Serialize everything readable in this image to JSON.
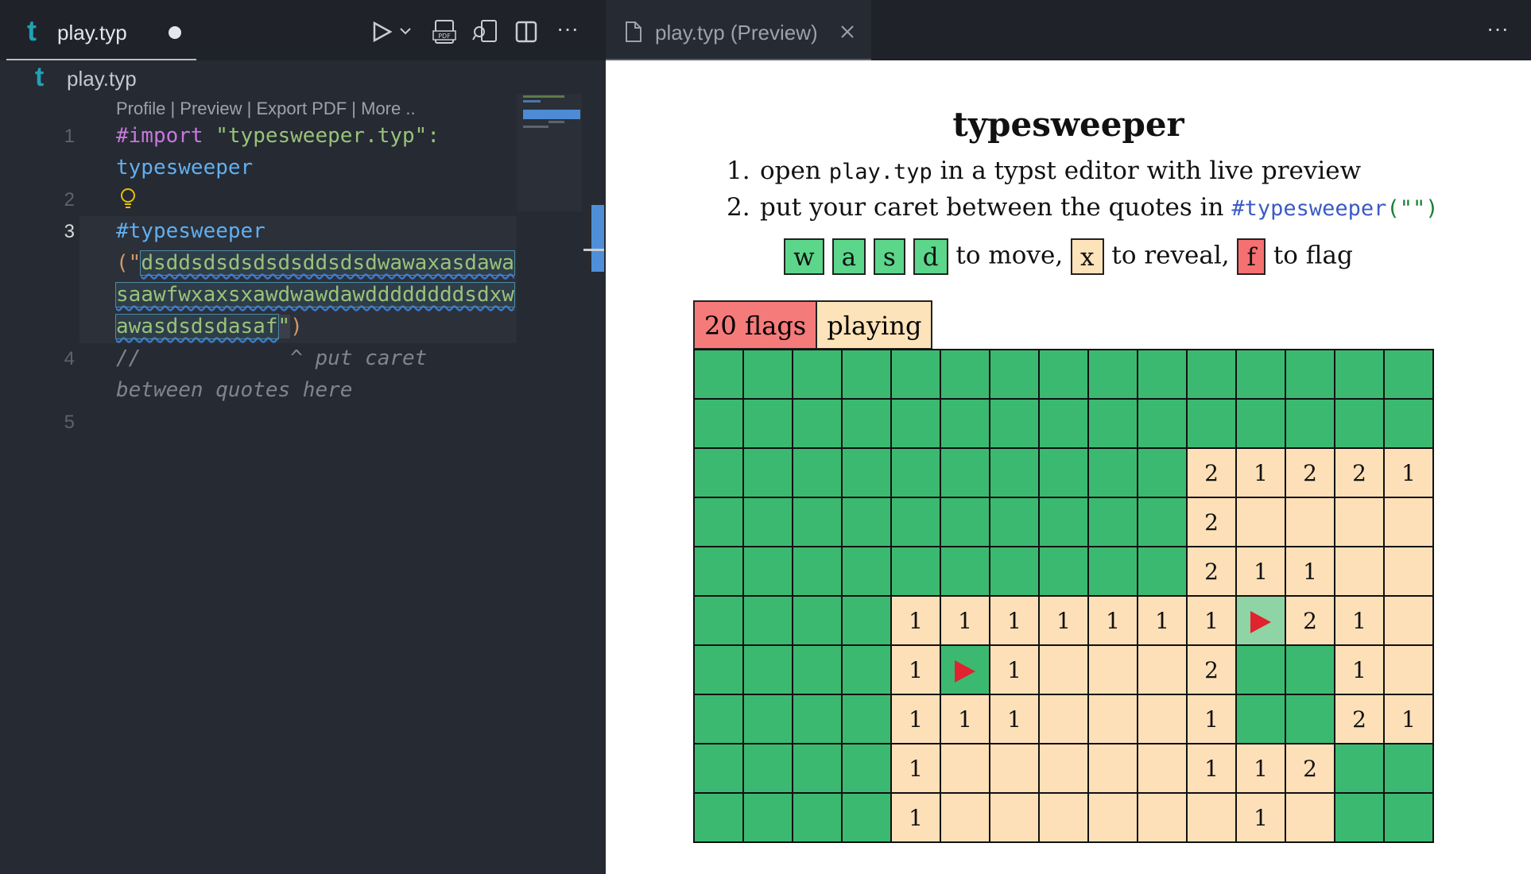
{
  "editor": {
    "tab_title": "play.typ",
    "breadcrumb": "play.typ",
    "codelens": "Profile | Preview | Export PDF | More ..",
    "line_numbers": [
      "1",
      "2",
      "3",
      "4",
      "5"
    ],
    "lines": {
      "l1a_kw": "#import",
      "l1a_str": " \"typesweeper.typ\":",
      "l1b_fn": "typesweeper",
      "l3a_fn": "#typesweeper",
      "l3b_open": "(\"",
      "l3b_sel": "dsddsdsdsdsdsddsdsdwawaxasdawa",
      "l3c_sel": "saawfwxaxsxawdwawdawddddddddsdxw",
      "l3d_sel": "awasdsdsdasaf",
      "l3d_close_quote": "\"",
      "l3d_close_paren": ")",
      "l4a": "//            ^ put caret",
      "l4b": "between quotes here"
    }
  },
  "preview": {
    "tab_title": "play.typ (Preview)",
    "title": "typesweeper",
    "list": {
      "n1": "1.",
      "item1_pre": "open ",
      "item1_code": "play.typ",
      "item1_post": " in a typst editor with live preview",
      "n2": "2.",
      "item2_pre": "put your caret between the quotes in ",
      "item2_code": "#typesweeper",
      "item2_code2": "(\"\")"
    },
    "keys": {
      "w": "w",
      "a": "a",
      "s": "s",
      "d": "d",
      "move_text": "to move,",
      "x": "x",
      "reveal_text": "to reveal,",
      "f": "f",
      "flag_text": "to flag"
    },
    "status": {
      "flags": "20 flags",
      "state": "playing"
    },
    "colors": {
      "hidden": "#3cb971",
      "revealed": "#fde0b8",
      "flag": "#e0232e",
      "selected": "#8fd4a5"
    },
    "board": [
      "HHHHHHHHHHHHHHH",
      "HHHHHHHHHHHHHHH",
      "HHHHHHHHHH21221",
      "HHHHHHHHHH2....",
      "HHHHHHHHHH211..",
      "HHHH1111111S21.",
      "HHHH1F1...2HH1.",
      "HHHH111...1HH21",
      "HHHH1.....112HH",
      "HHHH1......1.HH"
    ]
  }
}
